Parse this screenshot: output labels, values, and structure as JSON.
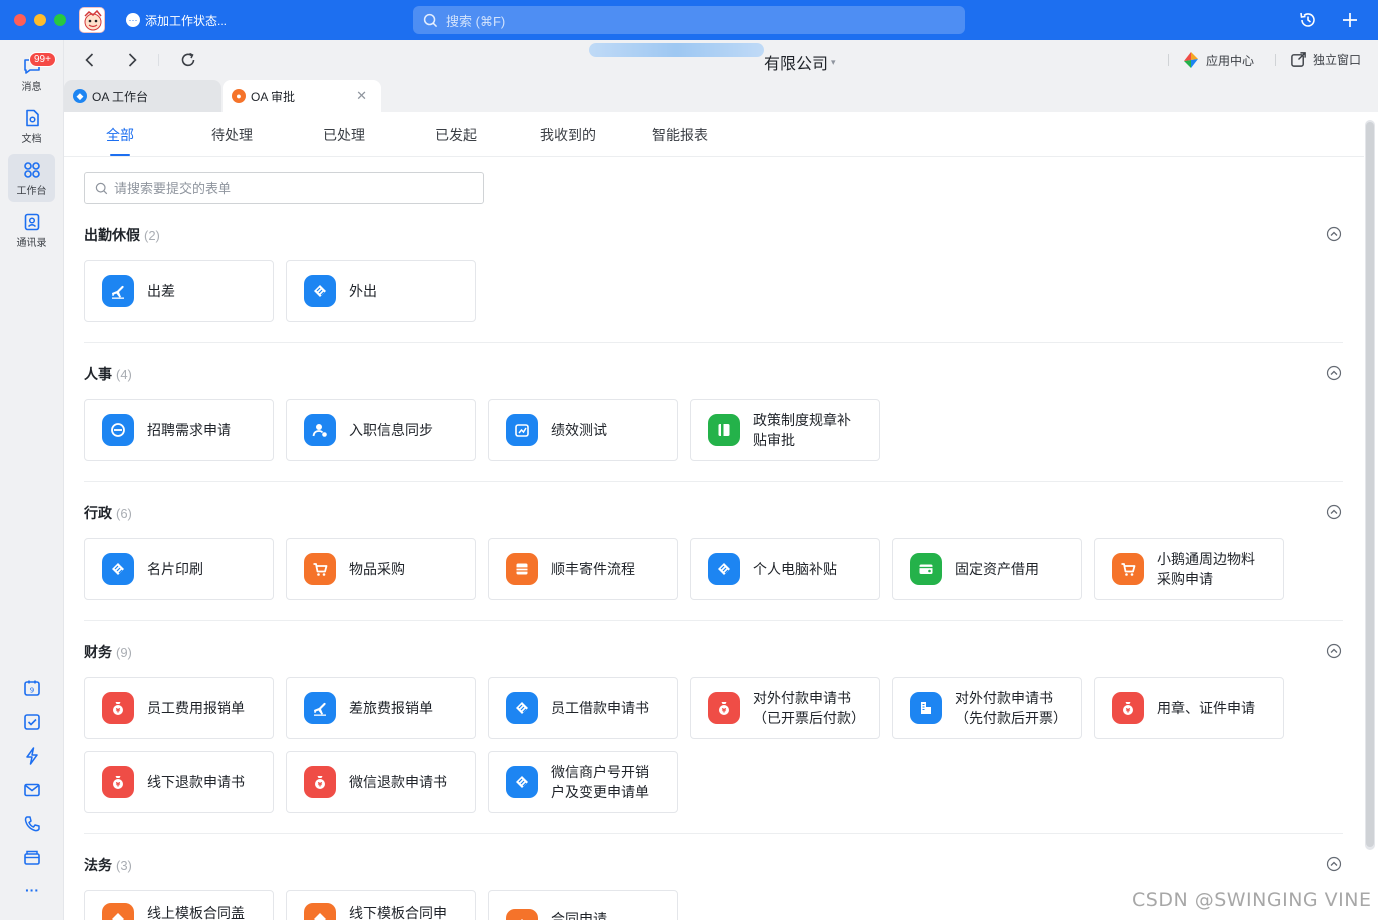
{
  "titlebar": {
    "status_text": "添加工作状态...",
    "search_placeholder": "搜索 (⌘F)"
  },
  "sidebar": {
    "badge": "99+",
    "items": [
      {
        "label": "消息",
        "icon": "message-icon"
      },
      {
        "label": "文档",
        "icon": "document-icon"
      },
      {
        "label": "工作台",
        "icon": "workbench-icon"
      },
      {
        "label": "通讯录",
        "icon": "contacts-icon"
      }
    ],
    "more": "···"
  },
  "navbar": {
    "company": "有限公司",
    "app_center": "应用中心",
    "standalone": "独立窗口"
  },
  "window_tabs": [
    {
      "label": "OA 工作台"
    },
    {
      "label": "OA 审批"
    }
  ],
  "tabs": [
    "全部",
    "待处理",
    "已处理",
    "已发起",
    "我收到的",
    "智能报表"
  ],
  "form_search": {
    "placeholder": "请搜索要提交的表单"
  },
  "sections": [
    {
      "title": "出勤休假",
      "count": "(2)",
      "items": [
        "出差",
        "外出"
      ]
    },
    {
      "title": "人事",
      "count": "(4)",
      "items": [
        "招聘需求申请",
        "入职信息同步",
        "绩效测试",
        "政策制度规章补贴审批"
      ]
    },
    {
      "title": "行政",
      "count": "(6)",
      "items": [
        "名片印刷",
        "物品采购",
        "顺丰寄件流程",
        "个人电脑补贴",
        "固定资产借用",
        "小鹅通周边物料采购申请"
      ]
    },
    {
      "title": "财务",
      "count": "(9)",
      "items": [
        "员工费用报销单",
        "差旅费报销单",
        "员工借款申请书",
        "对外付款申请书（已开票后付款）",
        "对外付款申请书（先付款后开票）",
        "用章、证件申请",
        "线下退款申请书",
        "微信退款申请书",
        "微信商户号开销户及变更申请单"
      ]
    },
    {
      "title": "法务",
      "count": "(3)",
      "items": [
        "线上模板合同盖",
        "线下模板合同申",
        "合同申请"
      ]
    }
  ],
  "colors": {
    "accent": "#1d6ff0",
    "icon_blue": "#1d85f2",
    "icon_orange": "#f5732a",
    "icon_red": "#ef4d46",
    "icon_green": "#24b24a"
  },
  "watermark": "CSDN @SWINGING   VINE"
}
